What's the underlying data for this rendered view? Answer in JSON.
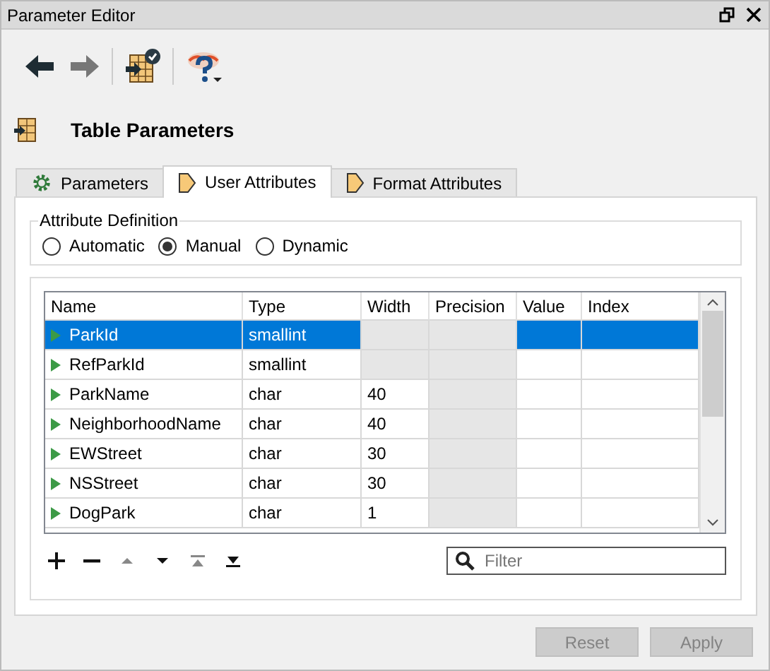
{
  "window": {
    "title": "Parameter Editor"
  },
  "toolbar": [
    {
      "kind": "back",
      "disabled": false
    },
    {
      "kind": "forward",
      "disabled": true
    },
    {
      "kind": "separator"
    },
    {
      "kind": "table-check"
    },
    {
      "kind": "separator"
    },
    {
      "kind": "help"
    }
  ],
  "heading": "Table Parameters",
  "tabs": [
    {
      "label": "Parameters",
      "selected": false
    },
    {
      "label": "User Attributes",
      "selected": true
    },
    {
      "label": "Format Attributes",
      "selected": false
    }
  ],
  "attribute_definition": {
    "title": "Attribute Definition",
    "options": [
      {
        "label": "Automatic",
        "selected": false
      },
      {
        "label": "Manual",
        "selected": true
      },
      {
        "label": "Dynamic",
        "selected": false
      }
    ]
  },
  "table": {
    "columns": [
      "Name",
      "Type",
      "Width",
      "Precision",
      "Value",
      "Index"
    ],
    "rows": [
      {
        "selected": true,
        "cells": [
          {
            "text": "ParkId",
            "disabled": false
          },
          {
            "text": "smallint",
            "disabled": false
          },
          {
            "disabled": true
          },
          {
            "disabled": true
          },
          {
            "disabled": false
          },
          {
            "disabled": false
          }
        ]
      },
      {
        "selected": false,
        "cells": [
          {
            "text": "RefParkId",
            "disabled": false
          },
          {
            "text": "smallint",
            "disabled": false
          },
          {
            "disabled": true
          },
          {
            "disabled": true
          },
          {
            "disabled": false
          },
          {
            "disabled": false
          }
        ]
      },
      {
        "selected": false,
        "cells": [
          {
            "text": "ParkName",
            "disabled": false
          },
          {
            "text": "char",
            "disabled": false
          },
          {
            "text": "40",
            "disabled": false
          },
          {
            "disabled": true
          },
          {
            "disabled": false
          },
          {
            "disabled": false
          }
        ]
      },
      {
        "selected": false,
        "cells": [
          {
            "text": "NeighborhoodName",
            "disabled": false
          },
          {
            "text": "char",
            "disabled": false
          },
          {
            "text": "40",
            "disabled": false
          },
          {
            "disabled": true
          },
          {
            "disabled": false
          },
          {
            "disabled": false
          }
        ]
      },
      {
        "selected": false,
        "cells": [
          {
            "text": "EWStreet",
            "disabled": false
          },
          {
            "text": "char",
            "disabled": false
          },
          {
            "text": "30",
            "disabled": false
          },
          {
            "disabled": true
          },
          {
            "disabled": false
          },
          {
            "disabled": false
          }
        ]
      },
      {
        "selected": false,
        "cells": [
          {
            "text": "NSStreet",
            "disabled": false
          },
          {
            "text": "char",
            "disabled": false
          },
          {
            "text": "30",
            "disabled": false
          },
          {
            "disabled": true
          },
          {
            "disabled": false
          },
          {
            "disabled": false
          }
        ]
      },
      {
        "selected": false,
        "cells": [
          {
            "text": "DogPark",
            "disabled": false
          },
          {
            "text": "char",
            "disabled": false
          },
          {
            "text": "1",
            "disabled": false
          },
          {
            "disabled": true
          },
          {
            "disabled": false
          },
          {
            "disabled": false
          }
        ]
      }
    ]
  },
  "table_tools": [
    {
      "kind": "add",
      "disabled": false
    },
    {
      "kind": "remove",
      "disabled": false
    },
    {
      "kind": "up",
      "disabled": true
    },
    {
      "kind": "down",
      "disabled": false
    },
    {
      "kind": "top",
      "disabled": true
    },
    {
      "kind": "bottom",
      "disabled": false
    }
  ],
  "filter": {
    "placeholder": "Filter"
  },
  "buttons": [
    {
      "label": "Reset",
      "disabled": true
    },
    {
      "label": "Apply",
      "disabled": true
    }
  ]
}
